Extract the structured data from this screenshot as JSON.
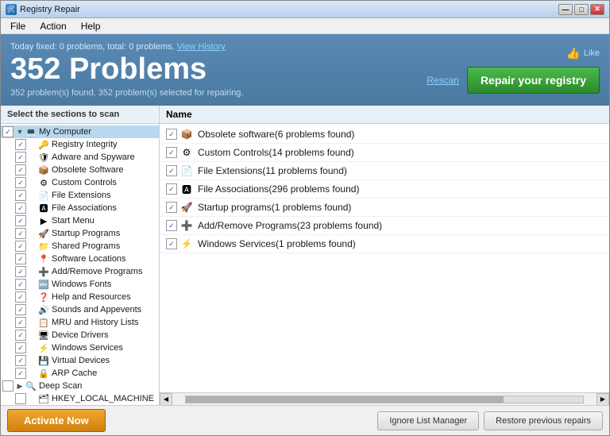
{
  "window": {
    "title": "Registry Repair",
    "title_icon": "🛠",
    "minimize_label": "—",
    "maximize_label": "□",
    "close_label": "✕"
  },
  "menu": {
    "items": [
      "File",
      "Action",
      "Help"
    ]
  },
  "header": {
    "today_fixed": "Today fixed: 0 problems, total: 0 problems.",
    "view_history": "View History",
    "like_label": "Like",
    "problems_count": "352 Problems",
    "subtext": "352 problem(s) found, 352 problem(s) selected for repairing.",
    "rescan_label": "Rescan",
    "repair_label": "Repair your registry"
  },
  "left_panel": {
    "header": "Select the sections to scan",
    "items": [
      {
        "level": 0,
        "checked": true,
        "expand": "▼",
        "icon": "💻",
        "label": "My Computer",
        "selected": true
      },
      {
        "level": 1,
        "checked": true,
        "expand": "",
        "icon": "🔑",
        "label": "Registry Integrity"
      },
      {
        "level": 1,
        "checked": true,
        "expand": "",
        "icon": "🛡",
        "label": "Adware and Spyware"
      },
      {
        "level": 1,
        "checked": true,
        "expand": "",
        "icon": "📦",
        "label": "Obsolete Software"
      },
      {
        "level": 1,
        "checked": true,
        "expand": "",
        "icon": "⚙",
        "label": "Custom Controls"
      },
      {
        "level": 1,
        "checked": true,
        "expand": "",
        "icon": "📄",
        "label": "File Extensions"
      },
      {
        "level": 1,
        "checked": true,
        "expand": "",
        "icon": "🅰",
        "label": "File Associations"
      },
      {
        "level": 1,
        "checked": true,
        "expand": "",
        "icon": "▶",
        "label": "Start Menu"
      },
      {
        "level": 1,
        "checked": true,
        "expand": "",
        "icon": "🚀",
        "label": "Startup Programs"
      },
      {
        "level": 1,
        "checked": true,
        "expand": "",
        "icon": "📁",
        "label": "Shared Programs"
      },
      {
        "level": 1,
        "checked": true,
        "expand": "",
        "icon": "📍",
        "label": "Software Locations"
      },
      {
        "level": 1,
        "checked": true,
        "expand": "",
        "icon": "➕",
        "label": "Add/Remove Programs"
      },
      {
        "level": 1,
        "checked": true,
        "expand": "",
        "icon": "🔤",
        "label": "Windows Fonts"
      },
      {
        "level": 1,
        "checked": true,
        "expand": "",
        "icon": "❓",
        "label": "Help and Resources"
      },
      {
        "level": 1,
        "checked": true,
        "expand": "",
        "icon": "🔊",
        "label": "Sounds and Appevents"
      },
      {
        "level": 1,
        "checked": true,
        "expand": "",
        "icon": "📋",
        "label": "MRU and History Lists"
      },
      {
        "level": 1,
        "checked": true,
        "expand": "",
        "icon": "🖥",
        "label": "Device Drivers"
      },
      {
        "level": 1,
        "checked": true,
        "expand": "",
        "icon": "⚡",
        "label": "Windows Services"
      },
      {
        "level": 1,
        "checked": true,
        "expand": "",
        "icon": "💾",
        "label": "Virtual Devices"
      },
      {
        "level": 1,
        "checked": true,
        "expand": "",
        "icon": "🔒",
        "label": "ARP Cache"
      },
      {
        "level": 0,
        "checked": false,
        "expand": "▶",
        "icon": "🔍",
        "label": "Deep Scan"
      },
      {
        "level": 1,
        "checked": false,
        "expand": "",
        "icon": "🗂",
        "label": "HKEY_LOCAL_MACHINE"
      }
    ]
  },
  "right_panel": {
    "header": "Name",
    "results": [
      {
        "checked": true,
        "icon": "📦",
        "label": "Obsolete software(6 problems found)"
      },
      {
        "checked": true,
        "icon": "⚙",
        "label": "Custom Controls(14 problems found)"
      },
      {
        "checked": true,
        "icon": "📄",
        "label": "File Extensions(11 problems found)"
      },
      {
        "checked": true,
        "icon": "🅰",
        "label": "File Associations(296 problems found)"
      },
      {
        "checked": true,
        "icon": "🚀",
        "label": "Startup programs(1 problems found)"
      },
      {
        "checked": true,
        "icon": "➕",
        "label": "Add/Remove Programs(23 problems found)"
      },
      {
        "checked": true,
        "icon": "⚡",
        "label": "Windows Services(1 problems found)"
      }
    ]
  },
  "bottom": {
    "activate_label": "Activate Now",
    "ignore_label": "Ignore List Manager",
    "restore_label": "Restore previous repairs"
  }
}
